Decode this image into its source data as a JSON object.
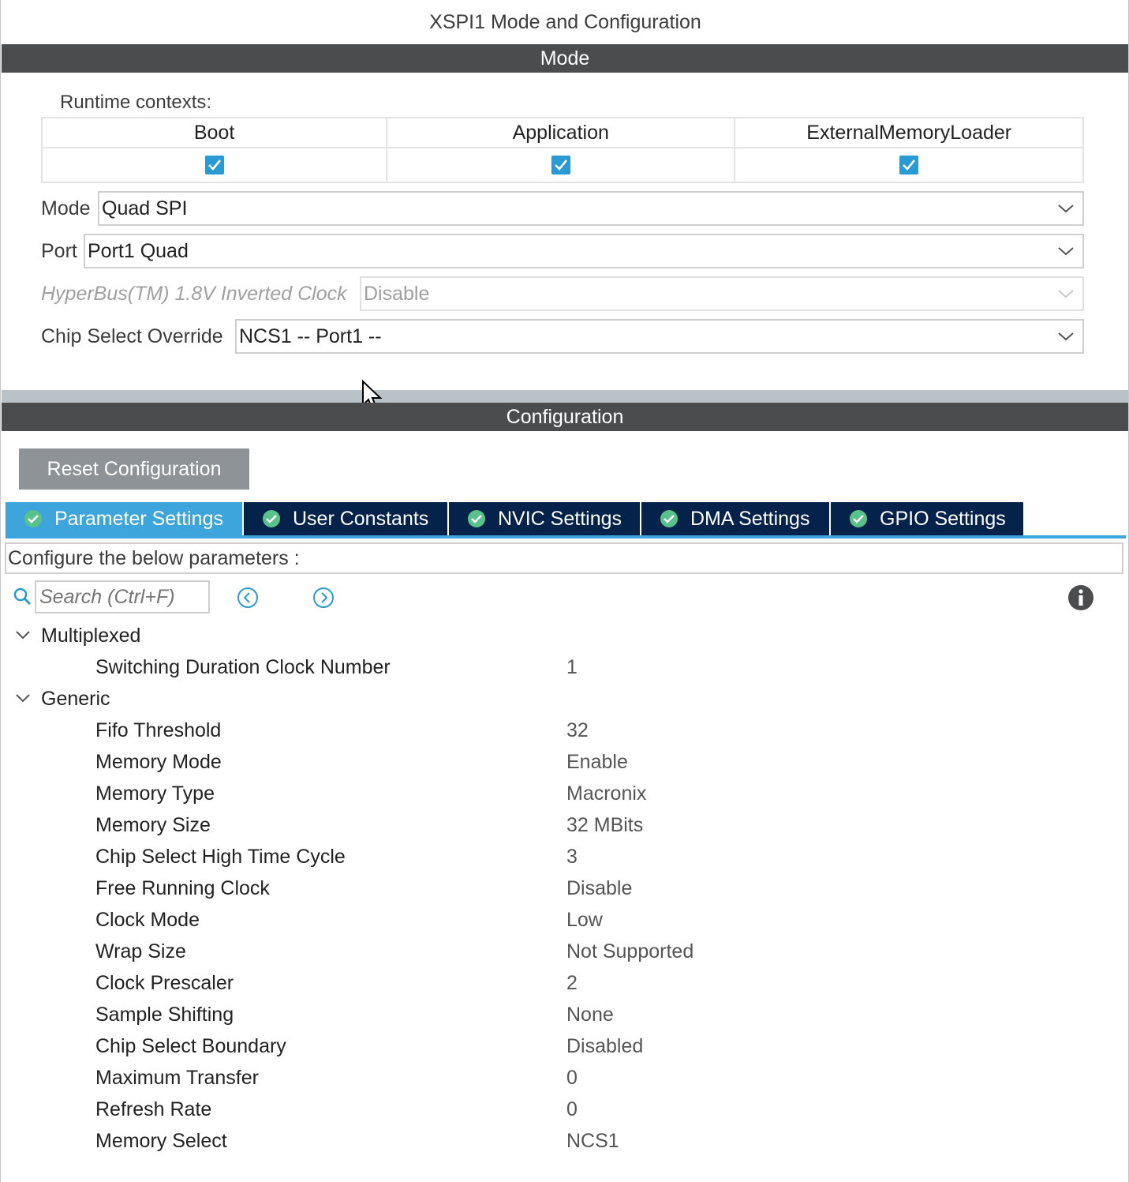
{
  "window": {
    "title": "XSPI1 Mode and Configuration"
  },
  "mode_section": {
    "header": "Mode",
    "runtime_label": "Runtime contexts:",
    "contexts": [
      {
        "label": "Boot",
        "checked": true
      },
      {
        "label": "Application",
        "checked": true
      },
      {
        "label": "ExternalMemoryLoader",
        "checked": true
      }
    ],
    "fields": {
      "mode": {
        "label": "Mode",
        "value": "Quad SPI"
      },
      "port": {
        "label": "Port",
        "value": "Port1 Quad"
      },
      "hyperbus": {
        "label": "HyperBus(TM) 1.8V Inverted Clock",
        "value": "Disable",
        "disabled": true
      },
      "chip_select": {
        "label": "Chip Select Override",
        "value": "NCS1 -- Port1 --"
      }
    }
  },
  "config_section": {
    "header": "Configuration",
    "reset_label": "Reset Configuration",
    "tabs": [
      {
        "label": "Parameter Settings",
        "active": true
      },
      {
        "label": "User Constants",
        "active": false
      },
      {
        "label": "NVIC Settings",
        "active": false
      },
      {
        "label": "DMA Settings",
        "active": false
      },
      {
        "label": "GPIO Settings",
        "active": false
      }
    ],
    "configure_text": "Configure the below parameters :",
    "search": {
      "placeholder": "Search (Ctrl+F)"
    },
    "groups": [
      {
        "label": "Multiplexed",
        "params": [
          {
            "name": "Switching Duration Clock Number",
            "value": "1"
          }
        ]
      },
      {
        "label": "Generic",
        "params": [
          {
            "name": "Fifo Threshold",
            "value": "32"
          },
          {
            "name": "Memory Mode",
            "value": "Enable"
          },
          {
            "name": "Memory Type",
            "value": "Macronix"
          },
          {
            "name": "Memory Size",
            "value": "32 MBits"
          },
          {
            "name": "Chip Select High Time Cycle",
            "value": "3"
          },
          {
            "name": "Free Running Clock",
            "value": "Disable"
          },
          {
            "name": "Clock Mode",
            "value": "Low"
          },
          {
            "name": "Wrap Size",
            "value": "Not Supported"
          },
          {
            "name": "Clock Prescaler",
            "value": "2"
          },
          {
            "name": "Sample Shifting",
            "value": "None"
          },
          {
            "name": "Chip Select Boundary",
            "value": "Disabled"
          },
          {
            "name": "Maximum Transfer",
            "value": "0"
          },
          {
            "name": "Refresh Rate",
            "value": "0"
          },
          {
            "name": "Memory Select",
            "value": "NCS1"
          }
        ]
      }
    ]
  },
  "colors": {
    "section_bar": "#4b4c4d",
    "tab_active": "#3ea5dc",
    "tab_inactive": "#05234a",
    "checkbox": "#2a9ad4",
    "ok_icon": "#58c28a"
  }
}
